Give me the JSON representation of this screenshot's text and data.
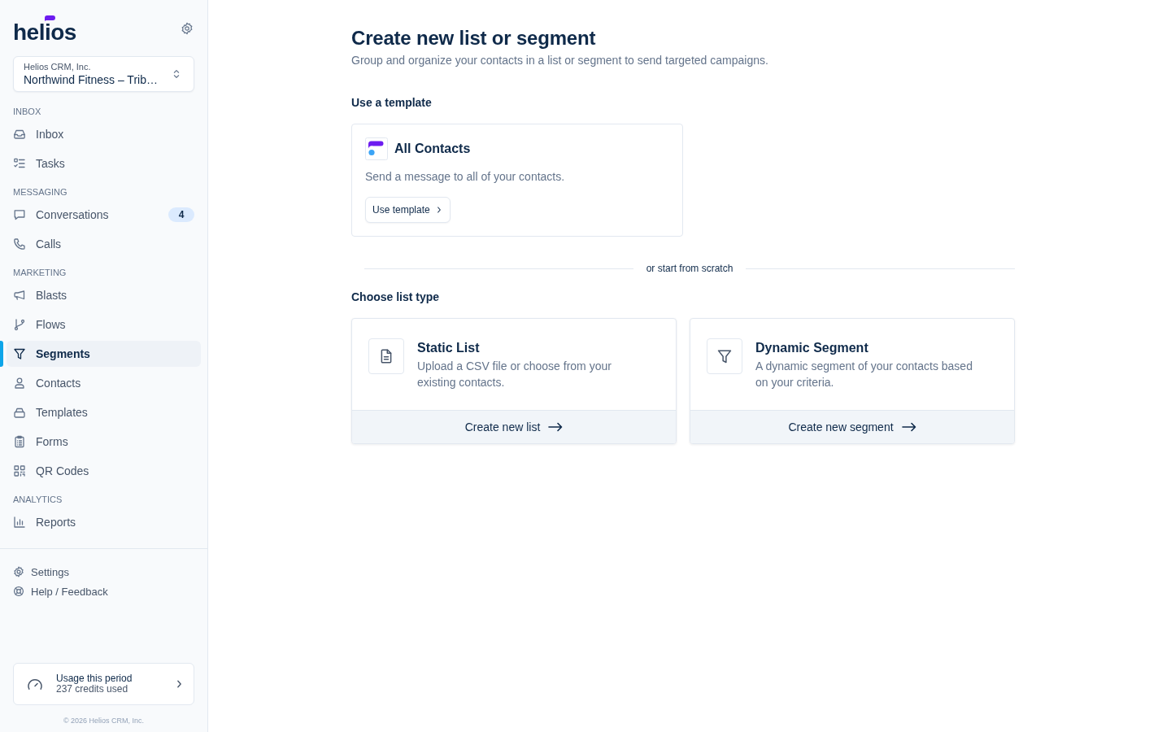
{
  "sidebar": {
    "logo": "helios",
    "workspace": {
      "organization": "Helios CRM, Inc.",
      "name": "Northwind Fitness – Trib…"
    },
    "sections": [
      {
        "label": "INBOX",
        "items": [
          {
            "label": "Inbox",
            "selected": false
          },
          {
            "label": "Tasks",
            "selected": false
          }
        ]
      },
      {
        "label": "MESSAGING",
        "items": [
          {
            "label": "Conversations",
            "badge": "4",
            "selected": false
          },
          {
            "label": "Calls",
            "selected": false
          }
        ]
      },
      {
        "label": "MARKETING",
        "items": [
          {
            "label": "Blasts",
            "selected": false
          },
          {
            "label": "Flows",
            "selected": false
          },
          {
            "label": "Segments",
            "selected": true
          },
          {
            "label": "Contacts",
            "selected": false
          },
          {
            "label": "Templates",
            "selected": false
          },
          {
            "label": "Forms",
            "selected": false
          },
          {
            "label": "QR Codes",
            "selected": false
          }
        ]
      },
      {
        "label": "ANALYTICS",
        "items": [
          {
            "label": "Reports",
            "selected": false
          }
        ]
      }
    ],
    "footer_links": [
      {
        "label": "Settings"
      },
      {
        "label": "Help / Feedback"
      }
    ],
    "usage": {
      "title": "Usage this period",
      "detail": "237 credits used"
    },
    "copyright": "© 2026 Helios CRM, Inc."
  },
  "main": {
    "title": "Create new list or segment",
    "subtitle": "Group and organize your contacts in a list or segment to send targeted campaigns.",
    "template_section": {
      "heading": "Use a template",
      "templates": [
        {
          "title": "All Contacts",
          "description": "Send a message to all of your contacts.",
          "button": "Use template"
        }
      ]
    },
    "divider": "or start from scratch",
    "list_type_section": {
      "heading": "Choose list type",
      "options": [
        {
          "title": "Static List",
          "description": "Upload a CSV file or choose from your existing contacts.",
          "action": "Create new list"
        },
        {
          "title": "Dynamic Segment",
          "description": "A dynamic segment of your contacts based on your criteria.",
          "action": "Create new segment"
        }
      ]
    }
  }
}
